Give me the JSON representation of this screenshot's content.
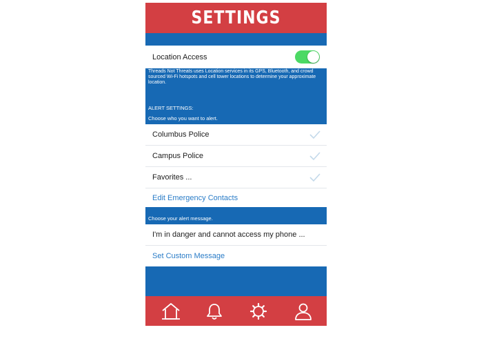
{
  "header": {
    "title": "SETTINGS"
  },
  "location": {
    "label": "Location Access",
    "enabled": true,
    "description": "Threads Not Threats uses Location services in its GPS, Bluetooth, and crowd sourced Wi-Fi hotspots and cell tower locations to determine your approximate location."
  },
  "alerts": {
    "section_title": "ALERT SETTINGS:",
    "subtitle": "Choose who you want to alert.",
    "recipients": [
      {
        "label": "Columbus Police",
        "checked": true
      },
      {
        "label": "Campus Police",
        "checked": true
      },
      {
        "label": "Favorites ...",
        "checked": true
      }
    ],
    "edit_contacts_label": "Edit Emergency Contacts"
  },
  "message": {
    "subtitle": "Choose your alert message.",
    "current": "I'm in danger and cannot access my phone ...",
    "custom_label": "Set Custom Message"
  },
  "tabbar": {
    "tabs": [
      {
        "icon": "home-icon"
      },
      {
        "icon": "bell-icon"
      },
      {
        "icon": "gear-icon"
      },
      {
        "icon": "user-icon"
      }
    ]
  },
  "colors": {
    "header": "#d33f43",
    "background": "#1769b4",
    "toggle_on": "#4cd964",
    "link": "#2a7cc7",
    "check": "#c3d9ea"
  }
}
